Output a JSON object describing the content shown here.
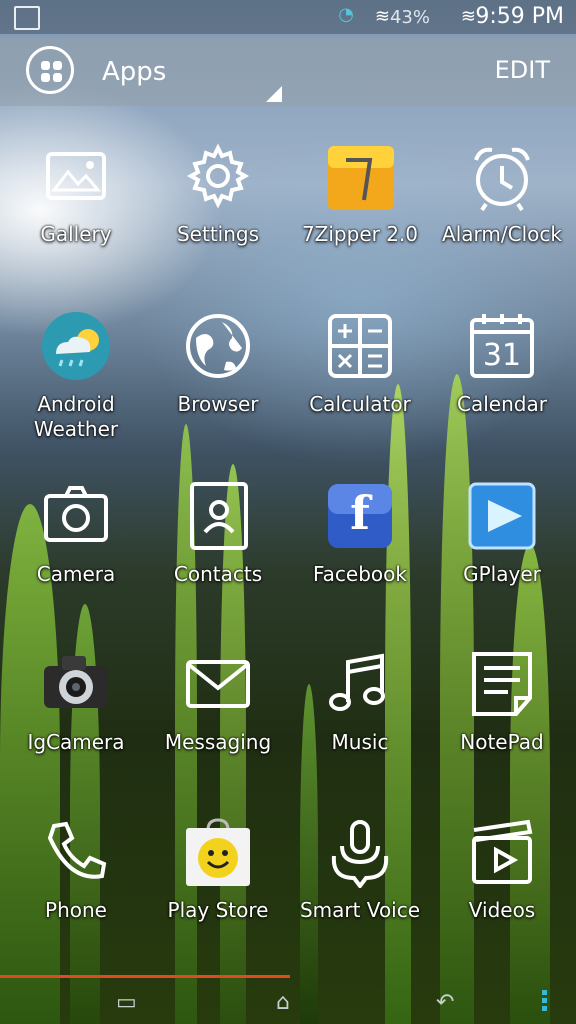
{
  "status": {
    "battery": "43%",
    "time": "9:59 PM"
  },
  "header": {
    "title": "Apps",
    "edit": "EDIT"
  },
  "apps": [
    {
      "label": "Gallery"
    },
    {
      "label": "Settings"
    },
    {
      "label": "7Zipper 2.0"
    },
    {
      "label": "Alarm/Clock"
    },
    {
      "label": "Android\nWeather"
    },
    {
      "label": "Browser"
    },
    {
      "label": "Calculator"
    },
    {
      "label": "Calendar",
      "badge": "31"
    },
    {
      "label": "Camera"
    },
    {
      "label": "Contacts"
    },
    {
      "label": "Facebook",
      "badge": "f"
    },
    {
      "label": "GPlayer"
    },
    {
      "label": "IgCamera"
    },
    {
      "label": "Messaging"
    },
    {
      "label": "Music"
    },
    {
      "label": "NotePad"
    },
    {
      "label": "Phone"
    },
    {
      "label": "Play Store"
    },
    {
      "label": "Smart Voice"
    },
    {
      "label": "Videos"
    }
  ]
}
